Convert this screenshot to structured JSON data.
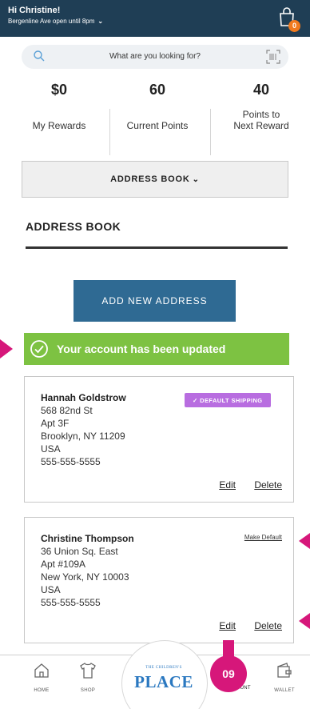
{
  "header": {
    "greeting": "Hi Christine!",
    "store_info": "Bergenline Ave open until 8pm",
    "cart_count": "0"
  },
  "search": {
    "placeholder": "What are you looking for?"
  },
  "rewards": {
    "my_rewards_value": "$0",
    "my_rewards_label": "My Rewards",
    "current_points_value": "60",
    "current_points_label": "Current Points",
    "next_reward_value": "40",
    "next_reward_label_line1": "Points to",
    "next_reward_label_line2": "Next Reward"
  },
  "address_book_dropdown": {
    "label": "ADDRESS BOOK"
  },
  "address_book": {
    "title": "ADDRESS BOOK",
    "add_button": "ADD NEW ADDRESS",
    "success_message": "Your account has been updated"
  },
  "addresses": [
    {
      "name": "Hannah Goldstrow",
      "line1": "568 82nd St",
      "line2": "Apt 3F",
      "city_line": "Brooklyn, NY 11209",
      "country": "USA",
      "phone": "555-555-5555",
      "badge": "✓ DEFAULT SHIPPING",
      "edit": "Edit",
      "delete": "Delete"
    },
    {
      "name": "Christine Thompson",
      "line1": "36 Union Sq. East",
      "line2": "Apt #109A",
      "city_line": "New York, NY 10003",
      "country": "USA",
      "phone": "555-555-5555",
      "make_default": "Make Default",
      "edit": "Edit",
      "delete": "Delete"
    }
  ],
  "bottom_nav": {
    "home": "HOME",
    "shop": "SHOP",
    "logo_small": "THE CHILDREN'S",
    "logo_big": "PLACE",
    "account": "ACCOUNT",
    "wallet": "WALLET"
  },
  "annotation": {
    "step": "09"
  },
  "colors": {
    "header_bg": "#1f3e55",
    "primary_button": "#2f6a93",
    "success_green": "#7dc242",
    "badge_purple": "#b86de0",
    "callout_magenta": "#d6177a",
    "cart_badge_orange": "#f07a1e",
    "logo_blue": "#2a78c0"
  }
}
